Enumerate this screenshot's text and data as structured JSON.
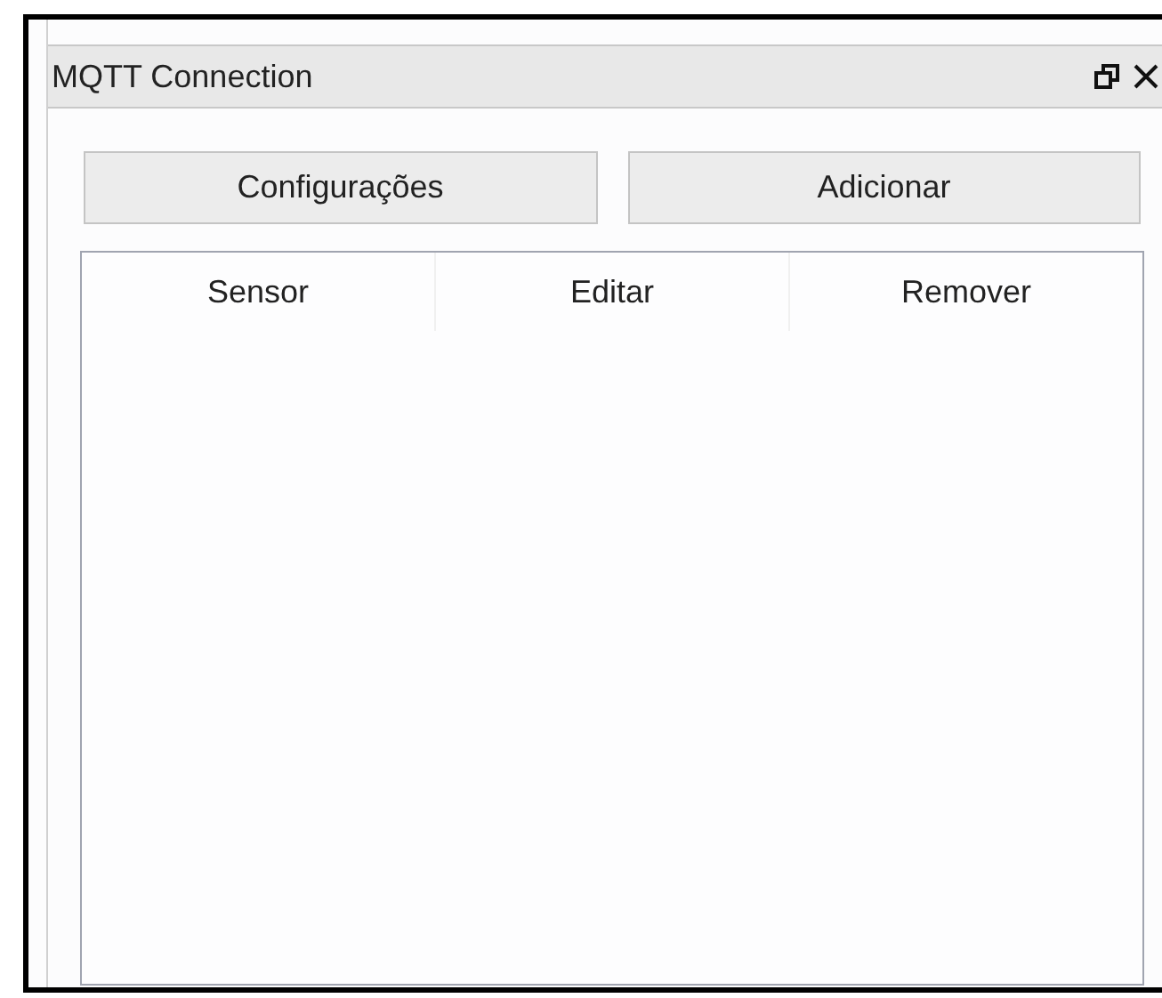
{
  "panel": {
    "title": "MQTT Connection"
  },
  "buttons": [
    "Configurações",
    "Adicionar"
  ],
  "table": {
    "columns": [
      "Sensor",
      "Editar",
      "Remover"
    ]
  }
}
